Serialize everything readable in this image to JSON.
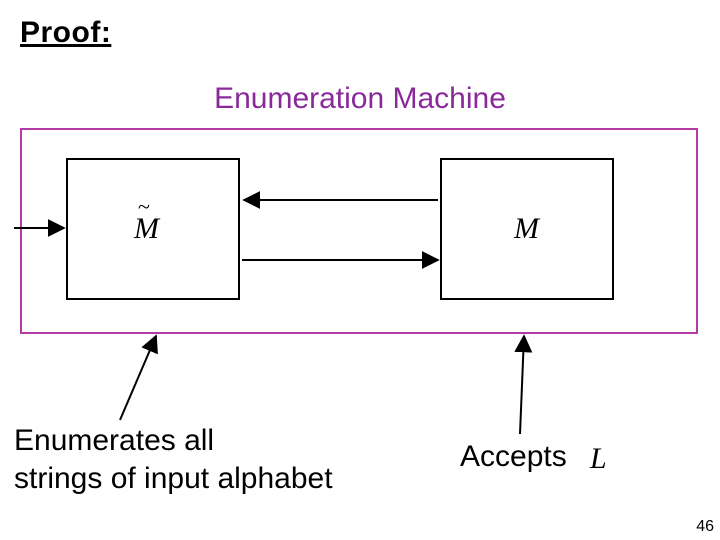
{
  "proof_label": "Proof:",
  "title": "Enumeration Machine",
  "boxes": {
    "left_symbol": "M",
    "right_symbol": "M"
  },
  "descriptions": {
    "left": "Enumerates all\nstrings of input alphabet",
    "right": "Accepts",
    "accepts_symbol": "L"
  },
  "colors": {
    "title": "#8a2a9a",
    "outer_box_stroke": "#b43aa5"
  },
  "page_number": "46"
}
